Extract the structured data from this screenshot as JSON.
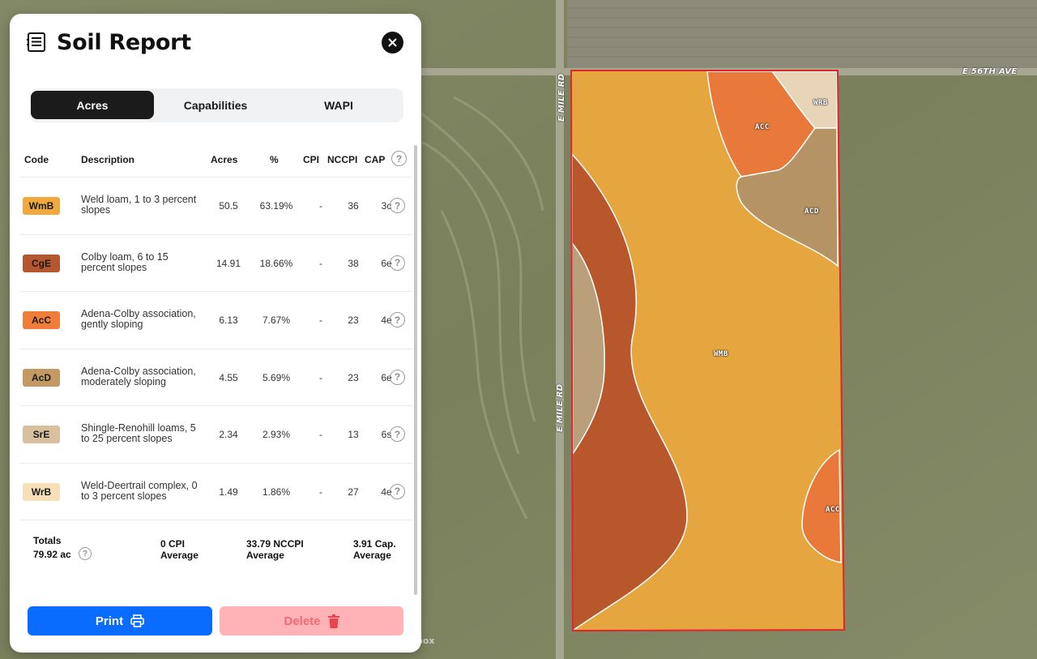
{
  "panel": {
    "title": "Soil Report",
    "tabs": [
      {
        "label": "Acres",
        "active": true
      },
      {
        "label": "Capabilities",
        "active": false
      },
      {
        "label": "WAPI",
        "active": false
      }
    ],
    "columns": {
      "code": "Code",
      "description": "Description",
      "acres": "Acres",
      "percent": "%",
      "cpi": "CPI",
      "nccpi": "NCCPI",
      "cap": "CAP"
    },
    "rows": [
      {
        "code": "WmB",
        "color": "#efa93c",
        "description": "Weld loam, 1 to 3 percent slopes",
        "acres": "50.5",
        "percent": "63.19%",
        "cpi": "-",
        "nccpi": "36",
        "cap": "3c"
      },
      {
        "code": "CgE",
        "color": "#b4562e",
        "description": "Colby loam, 6 to 15 percent slopes",
        "acres": "14.91",
        "percent": "18.66%",
        "cpi": "-",
        "nccpi": "38",
        "cap": "6e"
      },
      {
        "code": "AcC",
        "color": "#f07e3b",
        "description": "Adena-Colby association, gently sloping",
        "acres": "6.13",
        "percent": "7.67%",
        "cpi": "-",
        "nccpi": "23",
        "cap": "4e"
      },
      {
        "code": "AcD",
        "color": "#c39a63",
        "description": "Adena-Colby association, moderately sloping",
        "acres": "4.55",
        "percent": "5.69%",
        "cpi": "-",
        "nccpi": "23",
        "cap": "6e"
      },
      {
        "code": "SrE",
        "color": "#d8c09e",
        "description": "Shingle-Renohill loams, 5 to 25 percent slopes",
        "acres": "2.34",
        "percent": "2.93%",
        "cpi": "-",
        "nccpi": "13",
        "cap": "6s"
      },
      {
        "code": "WrB",
        "color": "#f7dfb8",
        "description": "Weld-Deertrail complex, 0 to 3 percent slopes",
        "acres": "1.49",
        "percent": "1.86%",
        "cpi": "-",
        "nccpi": "27",
        "cap": "4e"
      }
    ],
    "totals": {
      "label": "Totals",
      "acres": "79.92 ac",
      "cpi": "0 CPI",
      "cpi_sub": "Average",
      "nccpi": "33.79 NCCPI",
      "nccpi_sub": "Average",
      "cap": "3.91 Cap.",
      "cap_sub": "Average"
    },
    "buttons": {
      "print": "Print",
      "delete": "Delete"
    }
  },
  "map": {
    "road_labels": {
      "east_road": "E 56TH AVE",
      "mile_road_upper": "E MILE RD",
      "mile_road_lower": "E MILE RD"
    },
    "soil_labels": [
      "WRB",
      "ACC",
      "ACD",
      "WMB",
      "ACC"
    ],
    "attribution": "box"
  },
  "colors": {
    "accent": "#0a6cff",
    "delete": "#ffb3b6",
    "field_outline": "#e2242b"
  }
}
